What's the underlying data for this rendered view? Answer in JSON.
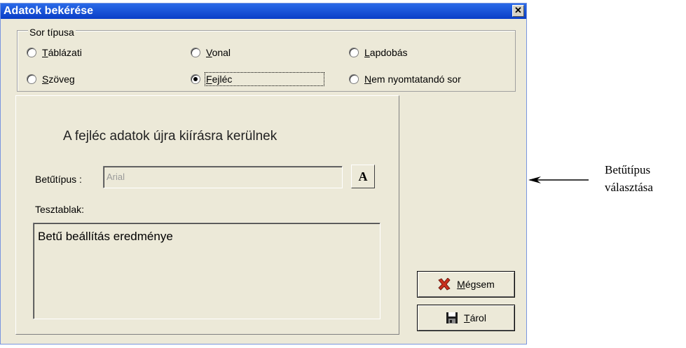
{
  "window": {
    "title": "Adatok bekérése"
  },
  "row_type": {
    "legend": "Sor típusa",
    "options": [
      {
        "label": "Táblázati",
        "hotkey": "T",
        "rest": "áblázati",
        "selected": false
      },
      {
        "label": "Vonal",
        "hotkey": "V",
        "rest": "onal",
        "selected": false
      },
      {
        "label": "Lapdobás",
        "hotkey": "L",
        "rest": "apdobás",
        "selected": false
      },
      {
        "label": "Szöveg",
        "hotkey": "S",
        "rest": "zöveg",
        "selected": false
      },
      {
        "label": "Fejléc",
        "hotkey": "F",
        "rest": "ejléc",
        "selected": true
      },
      {
        "label": "Nem nyomtatandó sor",
        "hotkey": "N",
        "rest": "em nyomtatandó sor",
        "selected": false
      }
    ]
  },
  "panel": {
    "heading": "A fejléc adatok újra kiírásra kerülnek",
    "font_label": "Betűtípus :",
    "font_value": "Arial",
    "font_button": "A",
    "test_label": "Tesztablak:",
    "test_text": "Betű beállítás eredménye"
  },
  "buttons": {
    "cancel": {
      "hotkey": "M",
      "rest": "égsem",
      "icon": "red-x-icon"
    },
    "save": {
      "hotkey": "T",
      "rest": "árol",
      "icon": "floppy-disk-icon"
    }
  },
  "annotation": {
    "line1": "Betűtípus",
    "line2": "választása"
  },
  "colors": {
    "titlebar": "#0a3ec7",
    "dialog_bg": "#ece9d8",
    "cancel_icon": "#c8301e"
  }
}
